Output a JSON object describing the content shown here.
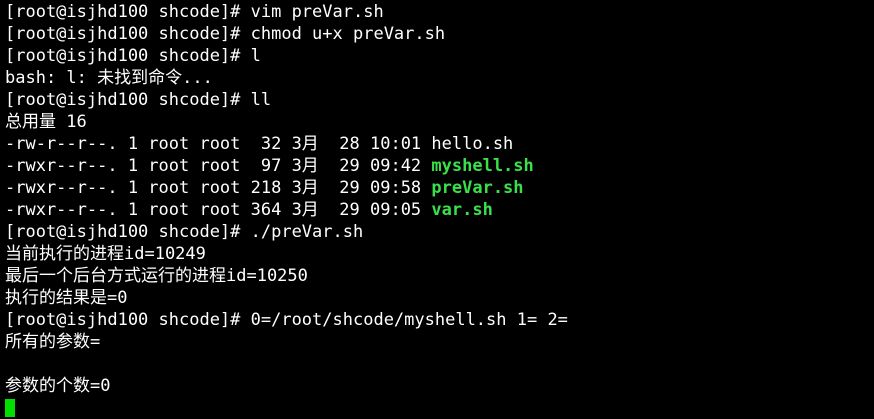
{
  "terminal": {
    "lines": [
      "[root@isjhd100 shcode]# vim preVar.sh",
      "[root@isjhd100 shcode]# chmod u+x preVar.sh",
      "[root@isjhd100 shcode]# l",
      "bash: l: 未找到命令...",
      "[root@isjhd100 shcode]# ll",
      "总用量 16"
    ],
    "listing": [
      {
        "meta": "-rw-r--r--. 1 root root  32 3月  28 10:01 ",
        "name": "hello.sh",
        "executable": false
      },
      {
        "meta": "-rwxr--r--. 1 root root  97 3月  29 09:42 ",
        "name": "myshell.sh",
        "executable": true
      },
      {
        "meta": "-rwxr--r--. 1 root root 218 3月  29 09:58 ",
        "name": "preVar.sh",
        "executable": true
      },
      {
        "meta": "-rwxr--r--. 1 root root 364 3月  29 09:05 ",
        "name": "var.sh",
        "executable": true
      }
    ],
    "output": [
      "[root@isjhd100 shcode]# ./preVar.sh",
      "当前执行的进程id=10249",
      "最后一个后台方式运行的进程id=10250",
      "执行的结果是=0",
      "[root@isjhd100 shcode]# 0=/root/shcode/myshell.sh 1= 2=",
      "所有的参数=",
      "",
      "参数的个数=0"
    ],
    "colors": {
      "background": "#000000",
      "text": "#ffffff",
      "executable": "#3ae04a",
      "cursor": "#00e000"
    }
  }
}
